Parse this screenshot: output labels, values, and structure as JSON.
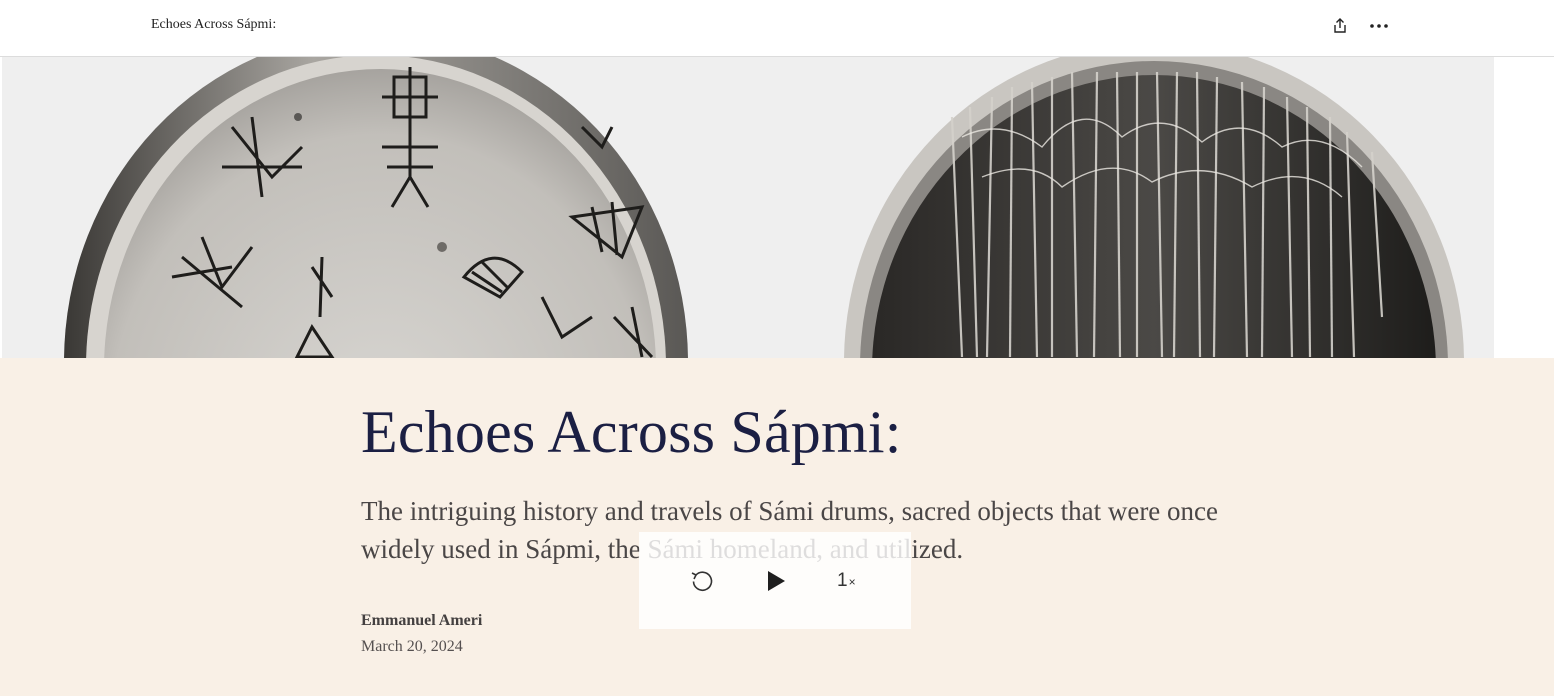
{
  "topbar": {
    "title": "Echoes Across Sápmi:",
    "share_icon": "share-icon",
    "more_icon": "more-horizontal-icon"
  },
  "hero": {
    "image_description": "Two Sámi drums: front with painted symbols, back with hanging fringes"
  },
  "article": {
    "headline": "Echoes Across Sápmi:",
    "subheadline": "The intriguing history and travels of Sámi drums, sacred objects that were once widely used in Sápmi, the Sámi homeland, and utilized.",
    "author": "Emmanuel Ameri",
    "date": "March 20, 2024"
  },
  "audio_player": {
    "replay_icon": "replay-icon",
    "play_icon": "play-icon",
    "speed_value": "1",
    "speed_suffix": "×"
  },
  "colors": {
    "panel_bg": "#f9f0e6",
    "headline": "#1b1f43",
    "body_text": "#4a4646"
  }
}
